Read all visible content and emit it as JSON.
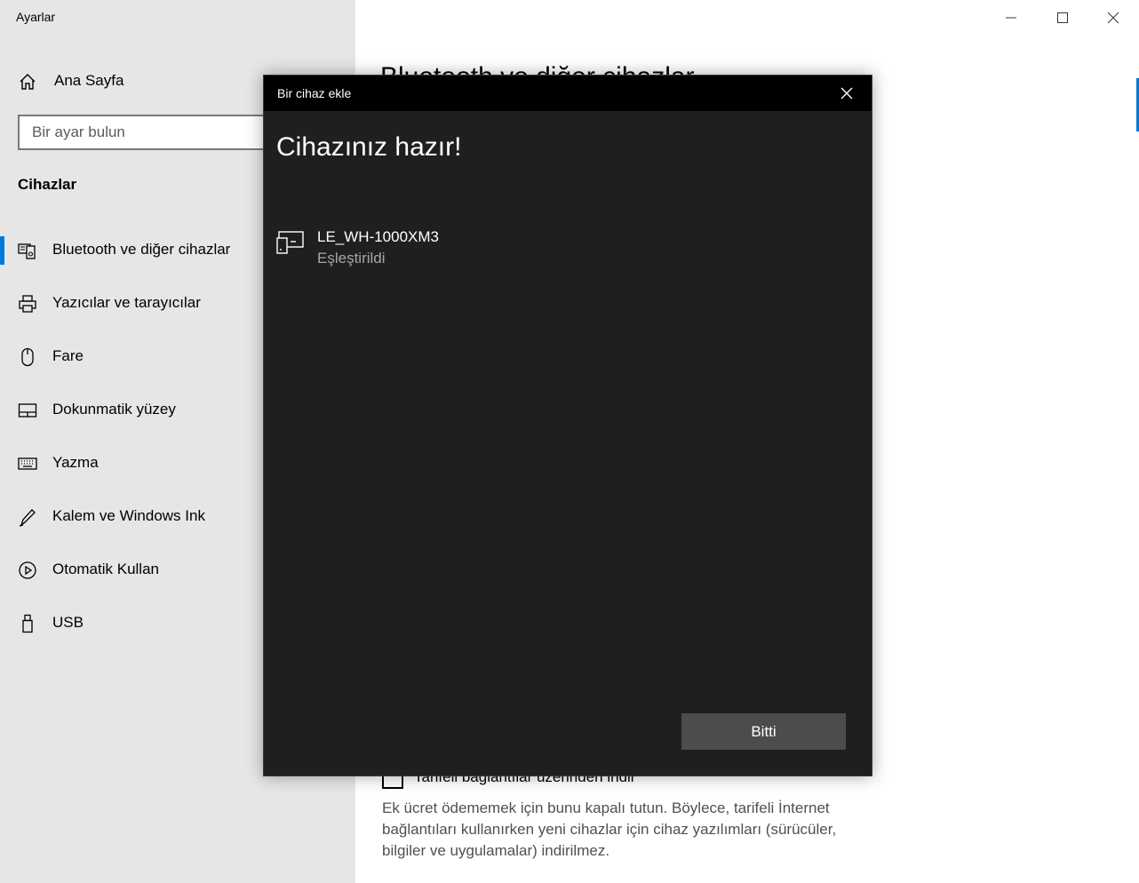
{
  "window": {
    "title": "Ayarlar",
    "page_heading": "Bluetooth ve diğer cihazlar"
  },
  "sidebar": {
    "home_label": "Ana Sayfa",
    "search_placeholder": "Bir ayar bulun",
    "section_title": "Cihazlar",
    "items": [
      {
        "label": "Bluetooth ve diğer cihazlar",
        "icon": "bluetooth-devices-icon",
        "selected": true
      },
      {
        "label": "Yazıcılar ve tarayıcılar",
        "icon": "printer-icon",
        "selected": false
      },
      {
        "label": "Fare",
        "icon": "mouse-icon",
        "selected": false
      },
      {
        "label": "Dokunmatik yüzey",
        "icon": "touchpad-icon",
        "selected": false
      },
      {
        "label": "Yazma",
        "icon": "keyboard-icon",
        "selected": false
      },
      {
        "label": "Kalem ve Windows Ink",
        "icon": "pen-icon",
        "selected": false
      },
      {
        "label": "Otomatik Kullan",
        "icon": "autoplay-icon",
        "selected": false
      },
      {
        "label": "USB",
        "icon": "usb-icon",
        "selected": false
      }
    ]
  },
  "main": {
    "metered_label": "Tarifeli bağlantılar üzerinden indir",
    "metered_checked": false,
    "metered_description": "Ek ücret ödememek için bunu kapalı tutun. Böylece, tarifeli İnternet bağlantıları kullanırken yeni cihazlar için cihaz yazılımları (sürücüler, bilgiler ve uygulamalar) indirilmez."
  },
  "dialog": {
    "title": "Bir cihaz ekle",
    "heading": "Cihazınız hazır!",
    "device": {
      "name": "LE_WH-1000XM3",
      "status": "Eşleştirildi",
      "icon": "device-icon"
    },
    "done_label": "Bitti"
  },
  "colors": {
    "accent": "#0078d7",
    "sidebar_bg": "#e6e6e6",
    "dialog_bg": "#1f1f1f",
    "dialog_titlebar": "#000000",
    "button_bg": "#4c4c4c"
  }
}
